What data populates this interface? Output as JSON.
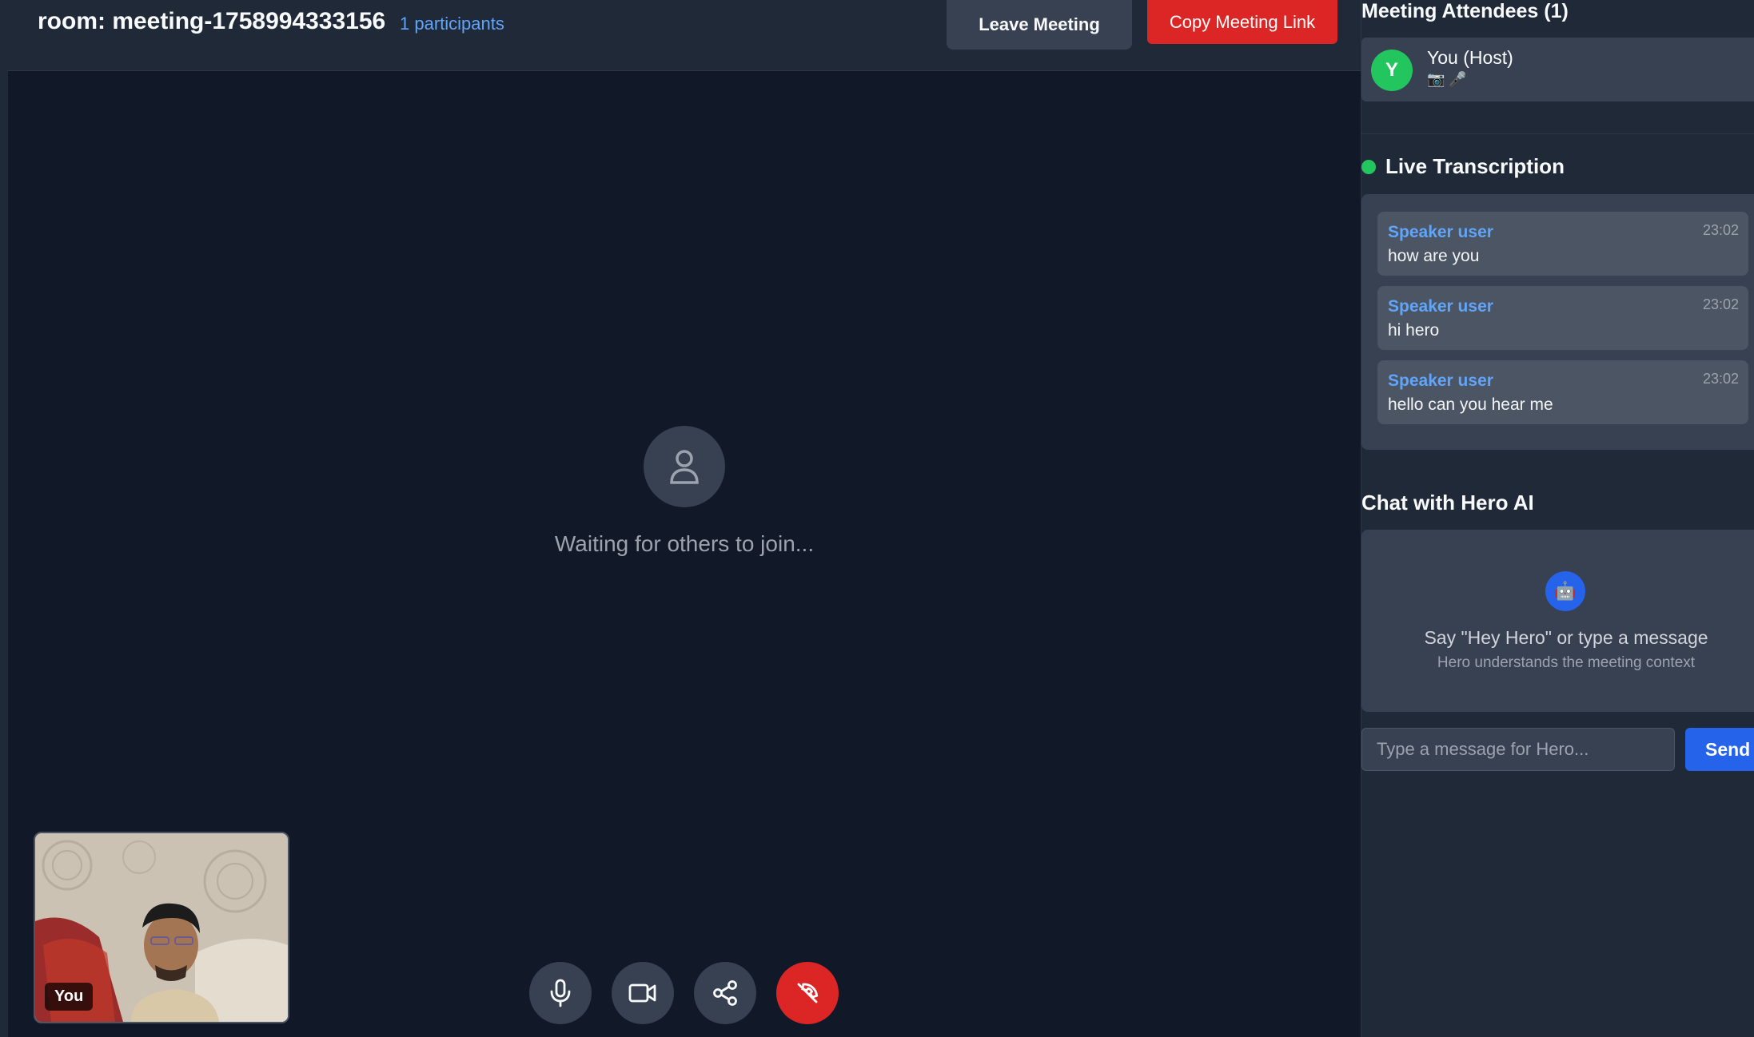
{
  "header": {
    "room_title": "room: meeting-1758994333156",
    "participants": "1 participants",
    "leave_label": "Leave Meeting",
    "copy_label": "Copy Meeting Link"
  },
  "stage": {
    "waiting_text": "Waiting for others to join..."
  },
  "self_view": {
    "label": "You"
  },
  "controls": [
    {
      "name": "microphone-icon"
    },
    {
      "name": "video-camera-icon"
    },
    {
      "name": "share-icon"
    },
    {
      "name": "end-call-icon"
    }
  ],
  "sidebar": {
    "attendees_title": "Meeting Attendees (1)",
    "attendee": {
      "initial": "Y",
      "name": "You (Host)",
      "status_icons": "📷 🎤"
    },
    "transcription_title": "Live Transcription",
    "transcripts": [
      {
        "speaker": "Speaker user",
        "time": "23:02",
        "text": "how are you"
      },
      {
        "speaker": "Speaker user",
        "time": "23:02",
        "text": "hi hero"
      },
      {
        "speaker": "Speaker user",
        "time": "23:02",
        "text": "hello can you hear me"
      }
    ],
    "chat_title": "Chat with Hero AI",
    "chat_hint": "Say \"Hey Hero\" or type a message",
    "chat_sub": "Hero understands the meeting context",
    "chat_placeholder": "Type a message for Hero...",
    "send_label": "Send"
  },
  "colors": {
    "background": "#111827",
    "panel": "#1f2937",
    "accent_blue": "#2563eb",
    "danger_red": "#dc2626",
    "live_green": "#22c55e"
  }
}
